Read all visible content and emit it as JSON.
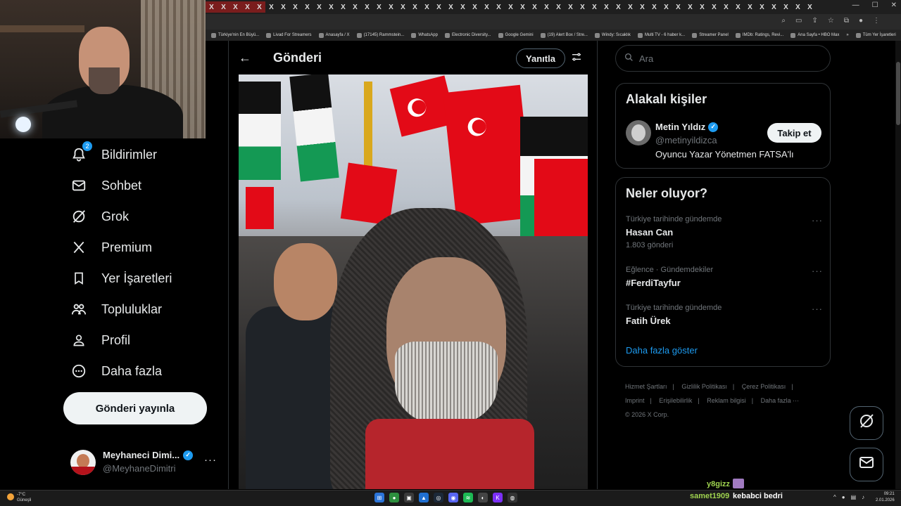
{
  "browser": {
    "tab_close_glyph": "X",
    "bookmarks": [
      "Türkiye'nin En Büyü...",
      "Livad For Streamers",
      "Anasayfa / X",
      "(17145) Rammstein...",
      "WhatsApp",
      "Electronic Diversity...",
      "Google Gemini",
      "(19) Alert Box / Stre...",
      "Windy: Sıcaklık",
      "Multi TV - 6 haber k...",
      "Streamer Panel",
      "IMDb: Ratings, Revi...",
      "Ana Sayfa • HBO Max",
      "»",
      "Tüm Yer İşaretleri"
    ]
  },
  "nav": {
    "notifications_badge": "2",
    "items": [
      {
        "label": "Bildirimler",
        "icon": "bell-icon"
      },
      {
        "label": "Sohbet",
        "icon": "mail-icon"
      },
      {
        "label": "Grok",
        "icon": "grok-icon"
      },
      {
        "label": "Premium",
        "icon": "x-logo-icon"
      },
      {
        "label": "Yer İşaretleri",
        "icon": "bookmark-icon"
      },
      {
        "label": "Topluluklar",
        "icon": "people-icon"
      },
      {
        "label": "Profil",
        "icon": "person-icon"
      },
      {
        "label": "Daha fazla",
        "icon": "more-circle-icon"
      }
    ],
    "post_button": "Gönderi yayınla",
    "account": {
      "name": "Meyhaneci Dimi...",
      "handle": "@MeyhaneDimitri",
      "more": "···"
    }
  },
  "center": {
    "back_glyph": "←",
    "title": "Gönderi",
    "reply_button": "Yanıtla",
    "filter_glyph": "⇄"
  },
  "right": {
    "search_placeholder": "Ara",
    "related": {
      "title": "Alakalı kişiler",
      "name": "Metin Yıldız",
      "handle": "@metinyildizca",
      "bio": "Oyuncu Yazar Yönetmen FATSA'lı",
      "follow_button": "Takip et"
    },
    "trends": {
      "title": "Neler oluyor?",
      "items": [
        {
          "meta": "Türkiye tarihinde gündemde",
          "name": "Hasan Can",
          "count": "1.803 gönderi"
        },
        {
          "meta": "Eğlence · Gündemdekiler",
          "name": "#FerdiTayfur",
          "count": ""
        },
        {
          "meta": "Türkiye tarihinde gündemde",
          "name": "Fatih Ürek",
          "count": ""
        }
      ],
      "more_glyph": "···",
      "show_more": "Daha fazla göster"
    },
    "footer": {
      "links": [
        "Hizmet Şartları",
        "|",
        "Gizlilik Politikası",
        "|",
        "Çerez Politikası",
        "|",
        "Imprint",
        "|",
        "Erişilebilirlik",
        "|",
        "Reklam bilgisi",
        "|",
        "Daha fazla ···"
      ],
      "copyright": "© 2026 X Corp."
    }
  },
  "taskbar": {
    "weather_temp": "-7°C",
    "weather_desc": "Güneşli",
    "chat": {
      "user1": "y8gizz",
      "user2": "samet1909",
      "message": "kebabci bedri"
    },
    "time": "09:21",
    "date": "2.01.2026"
  },
  "colors": {
    "accent": "#1d9bf0",
    "background": "#000000",
    "text": "#e7e9ea",
    "muted": "#71767b",
    "border": "#2f3336",
    "chat_username": "#9fd34f"
  }
}
